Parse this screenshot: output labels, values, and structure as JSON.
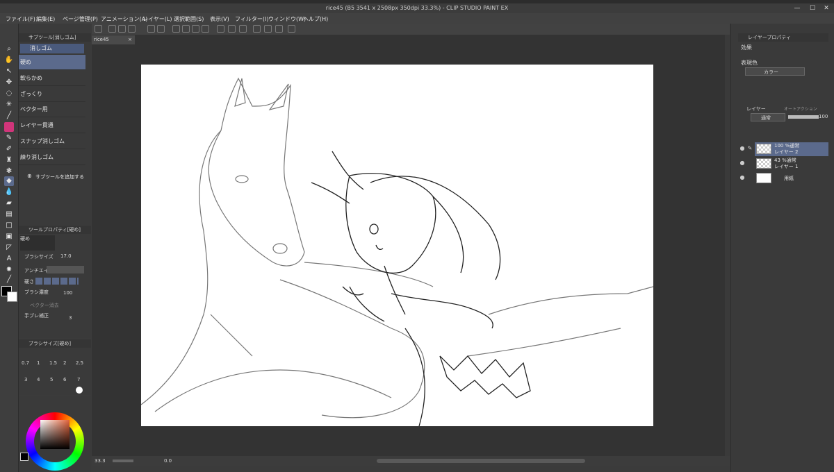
{
  "window": {
    "title": "rice45 (B5 3541 x 2508px 350dpi 33.3%)  - CLIP STUDIO PAINT EX",
    "minimize": "—",
    "maximize": "☐",
    "close": "✕"
  },
  "menu": [
    "ファイル(F)",
    "編集(E)",
    "ページ管理(P)",
    "アニメーション(A)",
    "レイヤー(L)",
    "選択範囲(S)",
    "表示(V)",
    "フィルター(I)",
    "ウィンドウ(W)",
    "ヘルプ(H)"
  ],
  "doc_tab": {
    "name": "rice45",
    "close": "×"
  },
  "subtool_panel": {
    "header": "サブツール[消しゴム]",
    "group": "消しゴム",
    "items": [
      "硬め",
      "軟らかめ",
      "ざっくり",
      "ベクター用",
      "レイヤー貫通",
      "スナップ消しゴム",
      "練り消しゴム"
    ],
    "selected_index": 0,
    "add_label": "サブツールを追加する"
  },
  "tool_property": {
    "header": "ツールプロパティ[硬め]",
    "preset_name": "硬め",
    "brush_size_label": "ブラシサイズ",
    "brush_size_value": "17.0",
    "antialias_label": "アンチエイリ",
    "hardness_label": "硬さ",
    "density_label": "ブラシ濃度",
    "density_value": "100",
    "vector_erase_label": "ベクター消去",
    "stabilization_label": "手ブレ補正",
    "stabilization_value": "3"
  },
  "brush_size_panel": {
    "header": "ブラシサイズ[硬め]",
    "sizes_row1": [
      "0.7",
      "1",
      "1.5",
      "2",
      "2.5"
    ],
    "sizes_row2": [
      "3",
      "4",
      "5",
      "6",
      "7"
    ]
  },
  "layer_property": {
    "header": "レイヤープロパティ",
    "effect_label": "効果",
    "expression_label": "表現色",
    "expression_value": "カラー"
  },
  "layers_panel": {
    "tab_layer": "レイヤー",
    "tab_auto": "オートアクション",
    "blend_mode": "通常",
    "opacity": "100",
    "layers": [
      {
        "line1": "100 %通常",
        "line2": "レイヤー 2",
        "selected": true
      },
      {
        "line1": "43 %通常",
        "line2": "レイヤー 1",
        "selected": false
      },
      {
        "line1": "",
        "line2": "用紙",
        "selected": false
      }
    ]
  },
  "status": {
    "zoom": "33.3",
    "angle": "0.0"
  },
  "colors": {
    "accent": "#5b6a8c",
    "main_color": "#000000",
    "sub_color": "#ffffff",
    "ui_bg": "#3b3b3b",
    "pink_tool": "#d0357a"
  }
}
